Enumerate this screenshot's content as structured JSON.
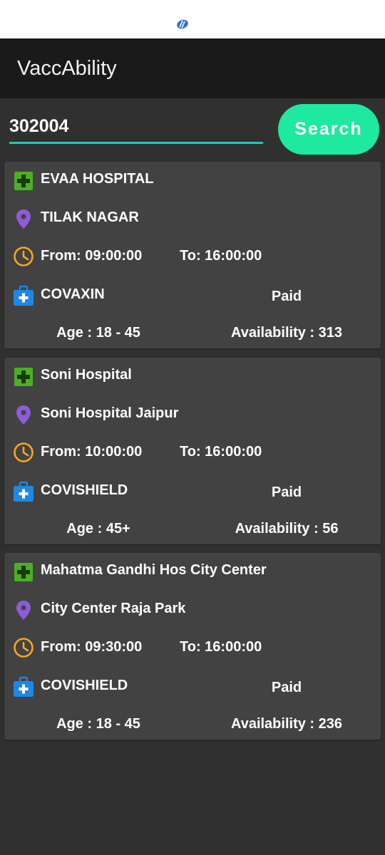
{
  "app": {
    "title": "VaccAbility"
  },
  "search": {
    "value": "302004",
    "button_label": "Search"
  },
  "colors": {
    "accent_teal": "#26c6b3",
    "button_green": "#1de9a0",
    "hospital_icon_green": "#4caf24",
    "location_icon_purple": "#8e5bd8",
    "clock_icon_orange": "#f5a623",
    "vaccine_icon_blue": "#1e88e5"
  },
  "icons": {
    "status": "app-logo-icon",
    "hospital": "hospital-cross-icon",
    "location": "location-pin-icon",
    "time": "clock-icon",
    "vaccine": "medical-kit-icon"
  },
  "centers": [
    {
      "name": "EVAA HOSPITAL",
      "address": "TILAK NAGAR",
      "from": "From: 09:00:00",
      "to": "To: 16:00:00",
      "vaccine": "COVAXIN",
      "fee": "Paid",
      "age": "Age : 18 - 45",
      "availability": "Availability : 313"
    },
    {
      "name": "Soni Hospital",
      "address": "Soni Hospital Jaipur",
      "from": "From: 10:00:00",
      "to": "To: 16:00:00",
      "vaccine": "COVISHIELD",
      "fee": "Paid",
      "age": "Age : 45+",
      "availability": "Availability : 56"
    },
    {
      "name": "Mahatma Gandhi Hos City Center",
      "address": "City Center Raja Park",
      "from": "From: 09:30:00",
      "to": "To: 16:00:00",
      "vaccine": "COVISHIELD",
      "fee": "Paid",
      "age": "Age : 18 - 45",
      "availability": "Availability : 236"
    }
  ]
}
